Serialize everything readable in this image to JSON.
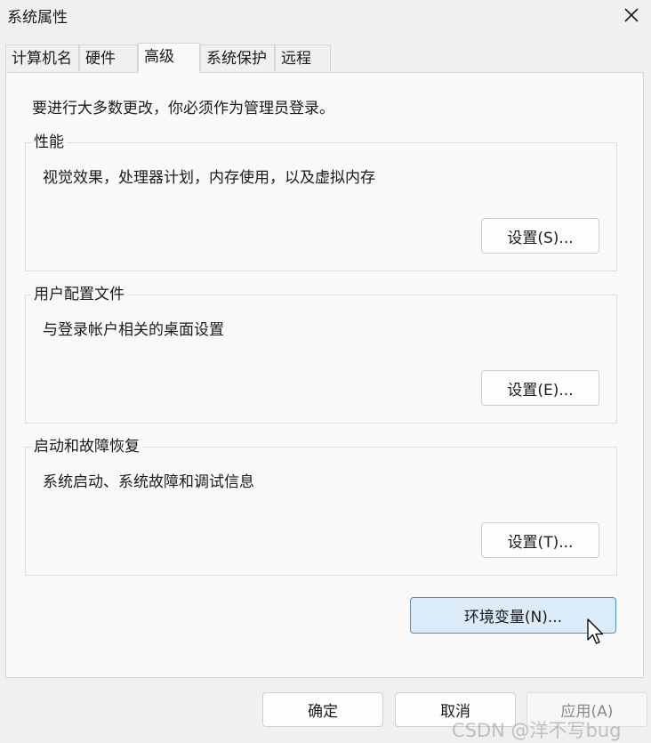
{
  "window": {
    "title": "系统属性",
    "close_icon": "close-icon"
  },
  "tabs": [
    {
      "label": "计算机名",
      "active": false
    },
    {
      "label": "硬件",
      "active": false
    },
    {
      "label": "高级",
      "active": true
    },
    {
      "label": "系统保护",
      "active": false
    },
    {
      "label": "远程",
      "active": false
    }
  ],
  "advanced": {
    "admin_note": "要进行大多数更改，你必须作为管理员登录。",
    "groups": [
      {
        "title": "性能",
        "description": "视觉效果，处理器计划，内存使用，以及虚拟内存",
        "button": "设置(S)..."
      },
      {
        "title": "用户配置文件",
        "description": "与登录帐户相关的桌面设置",
        "button": "设置(E)..."
      },
      {
        "title": "启动和故障恢复",
        "description": "系统启动、系统故障和调试信息",
        "button": "设置(T)..."
      }
    ],
    "env_button": "环境变量(N)..."
  },
  "footer": {
    "ok": "确定",
    "cancel": "取消",
    "apply": "应用(A)"
  },
  "watermark": "CSDN @洋不写bug",
  "colors": {
    "accent_border": "#4a8fd6",
    "hover_fill": "#dcebf8"
  }
}
